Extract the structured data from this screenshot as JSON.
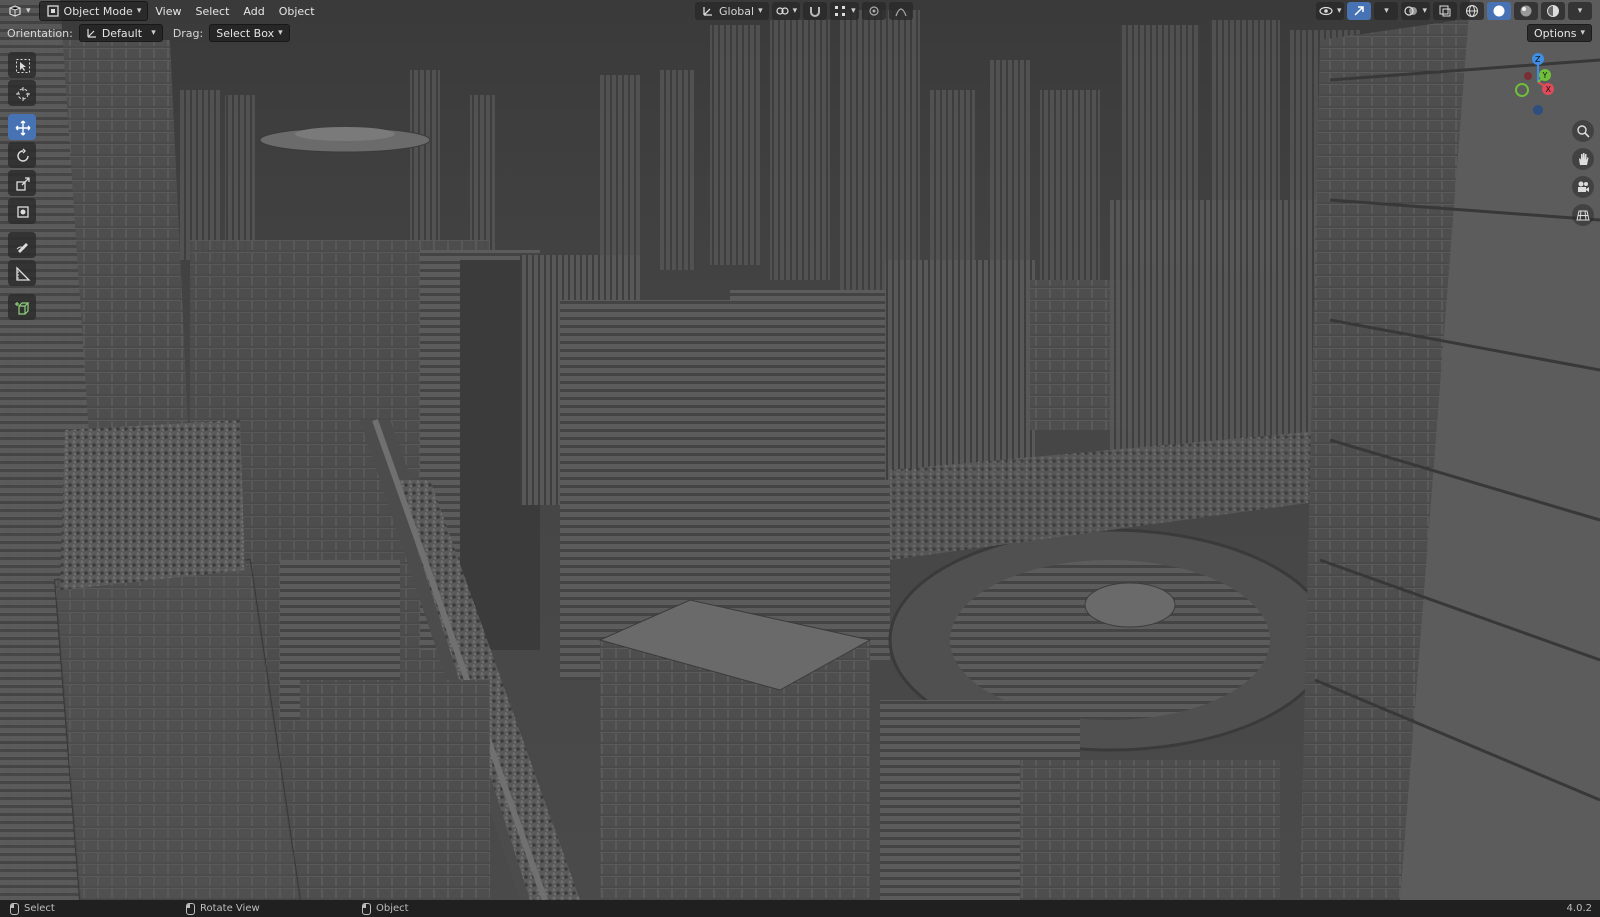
{
  "header": {
    "editor_icon": "3d-viewport-icon",
    "mode_label": "Object Mode",
    "menus": [
      "View",
      "Select",
      "Add",
      "Object"
    ],
    "transform_orientation": "Global"
  },
  "tool_settings": {
    "orientation_label": "Orientation:",
    "orientation_value": "Default",
    "drag_label": "Drag:",
    "drag_value": "Select Box",
    "options_label": "Options"
  },
  "toolbar": {
    "tools": [
      "select-box",
      "cursor",
      "move",
      "rotate",
      "scale",
      "transform",
      "annotate",
      "measure",
      "add-cube"
    ],
    "active_tool": "move"
  },
  "gizmo": {
    "axes": [
      "X",
      "Y",
      "Z"
    ]
  },
  "status_bar": {
    "left_click": "Select",
    "middle_click": "Rotate View",
    "right_click": "Object",
    "version": "4.0.2"
  },
  "colors": {
    "accent": "#4772b3",
    "axis_x": "#e04b59",
    "axis_y": "#6fbf3a",
    "axis_z": "#3f8ee6"
  }
}
